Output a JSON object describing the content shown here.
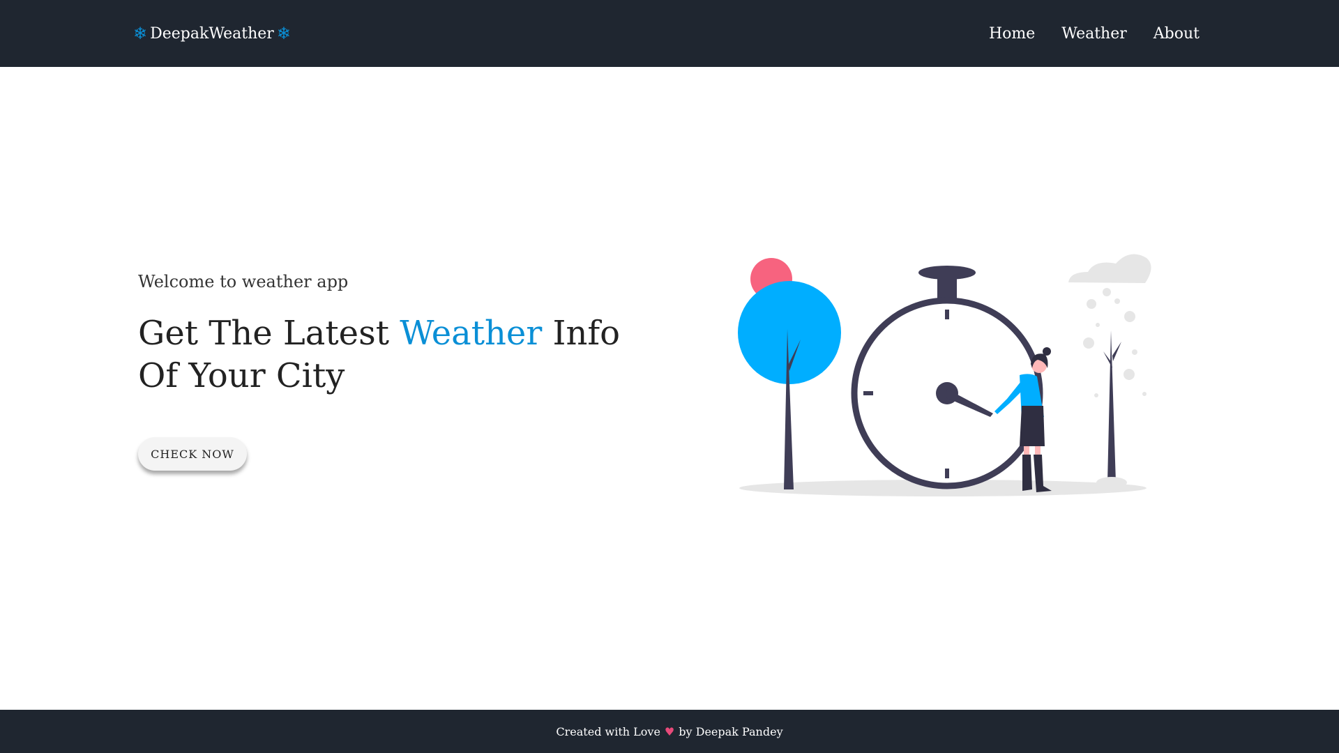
{
  "navbar": {
    "brand": "DeepakWeather",
    "brand_icon": "snowflake-icon",
    "links": [
      "Home",
      "Weather",
      "About"
    ]
  },
  "hero": {
    "welcome": "Welcome to weather app",
    "headline_prefix": "Get The Latest ",
    "headline_accent": "Weather",
    "headline_suffix": " Info Of Your City",
    "cta_label": "CHECK NOW",
    "illustration_icon": "stopwatch-woman-illustration"
  },
  "footer": {
    "prefix": "Created with Love",
    "heart_icon": "heart-icon",
    "suffix": "by Deepak Pandey"
  },
  "colors": {
    "nav_bg": "#1f2630",
    "accent": "#0a8fd6",
    "tree_blue": "#00aeff",
    "sun_pink": "#f7637f",
    "clock_dark": "#3f3d56"
  }
}
